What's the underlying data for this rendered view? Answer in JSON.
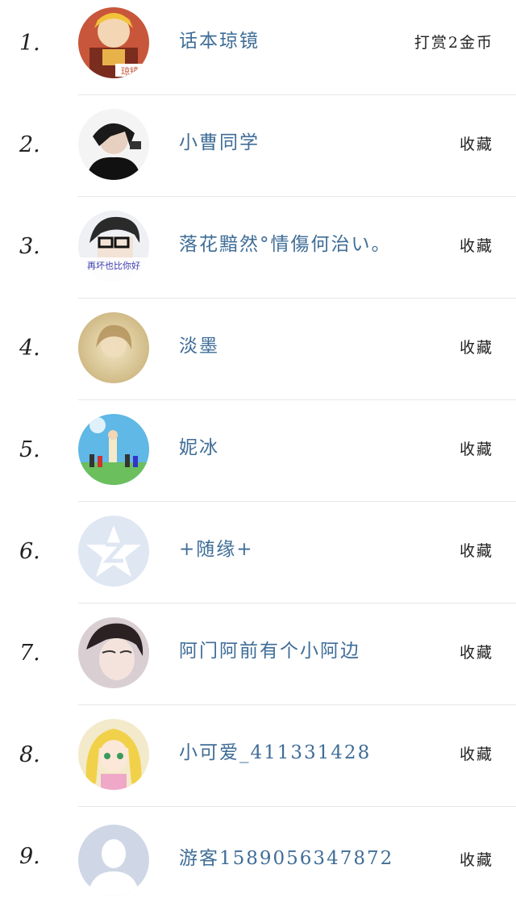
{
  "supporters": [
    {
      "rank": "1.",
      "name": "话本琼镜",
      "action": "打赏2金币",
      "avatar": "anime-boy-avatar"
    },
    {
      "rank": "2.",
      "name": "小曹同学",
      "action": "收藏",
      "avatar": "dark-hair-boy-avatar"
    },
    {
      "rank": "3.",
      "name": "落花黯然°情傷何治い。",
      "action": "收藏",
      "avatar": "glasses-boy-avatar",
      "avatar_caption": "再坏也比你好"
    },
    {
      "rank": "4.",
      "name": "淡墨",
      "action": "收藏",
      "avatar": "faded-girl-avatar"
    },
    {
      "rank": "5.",
      "name": "妮冰",
      "action": "收藏",
      "avatar": "anime-group-avatar"
    },
    {
      "rank": "6.",
      "name": "+随缘+",
      "action": "收藏",
      "avatar": "default-qzone-star-avatar"
    },
    {
      "rank": "7.",
      "name": "阿门阿前有个小阿边",
      "action": "收藏",
      "avatar": "boy-portrait-avatar"
    },
    {
      "rank": "8.",
      "name": "小可爱_411331428",
      "action": "收藏",
      "avatar": "blonde-anime-girl-avatar"
    },
    {
      "rank": "9.",
      "name": "游客1589056347872",
      "action": "收藏",
      "avatar": "default-person-avatar"
    }
  ],
  "colors": {
    "name_text": "#3f6d97",
    "rank_text": "#222222",
    "divider": "#e6e6e6"
  }
}
